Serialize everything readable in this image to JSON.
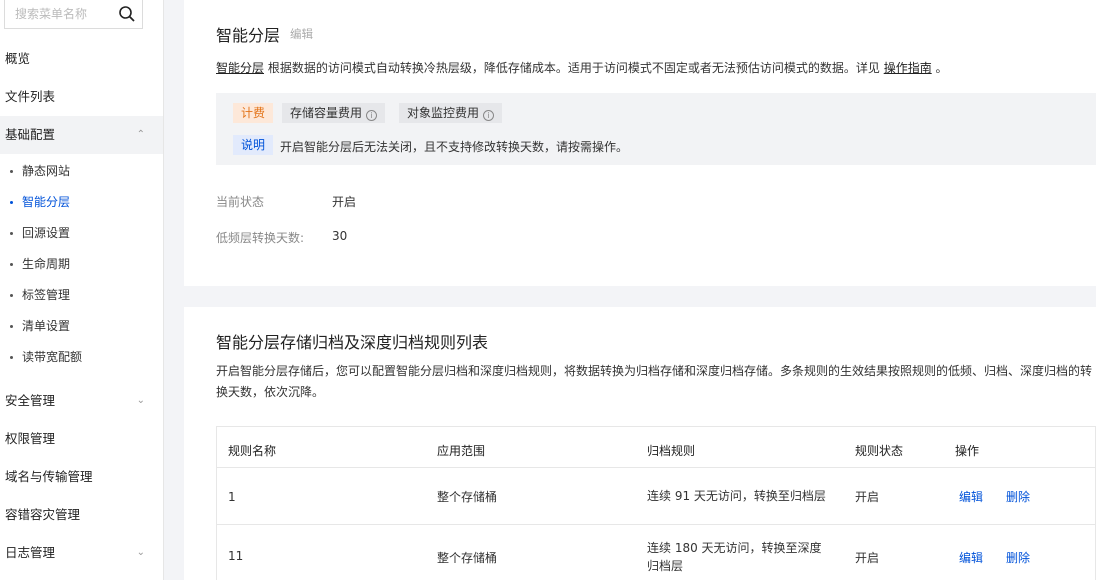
{
  "sidebar": {
    "search": {
      "placeholder": "搜索菜单名称",
      "value": ""
    },
    "items": {
      "overview": "概览",
      "file_list": "文件列表",
      "basic_config": "基础配置",
      "security": "安全管理",
      "permission": "权限管理",
      "domain": "域名与传输管理",
      "disaster": "容错容灾管理",
      "log": "日志管理"
    },
    "sub_items": {
      "static_site": "静态网站",
      "intelligent_tiering": "智能分层",
      "origin": "回源设置",
      "lifecycle": "生命周期",
      "tags": "标签管理",
      "inventory": "清单设置",
      "bandwidth": "读带宽配额"
    },
    "active_sub_item": "智能分层"
  },
  "tiering": {
    "title": "智能分层",
    "edit_label": "编辑",
    "desc_link": "智能分层",
    "desc_text": "根据数据的访问模式自动转换冷热层级，降低存储成本。适用于访问模式不固定或者无法预估访问模式的数据。详见",
    "guide_link": "操作指南",
    "desc_end": "。",
    "notice": {
      "billing_tag": "计费",
      "storage_fee": "存储容量费用",
      "monitor_fee": "对象监控费用",
      "info_tag": "说明",
      "info_text": "开启智能分层后无法关闭，且不支持修改转换天数，请按需操作。"
    },
    "status_label": "当前状态",
    "status_value": "开启",
    "days_label": "低频层转换天数:",
    "days_value": "30"
  },
  "rules": {
    "title": "智能分层存储归档及深度归档规则列表",
    "description": "开启智能分层存储后，您可以配置智能分层归档和深度归档规则，将数据转换为归档存储和深度归档存储。多条规则的生效结果按照规则的低频、归档、深度归档的转换天数，依次沉降。",
    "columns": {
      "name": "规则名称",
      "scope": "应用范围",
      "rule": "归档规则",
      "status": "规则状态",
      "ops": "操作"
    },
    "rows": [
      {
        "name": "1",
        "scope": "整个存储桶",
        "rule": "连续 91 天无访问，转换至归档层",
        "status": "开启",
        "edit": "编辑",
        "delete": "删除"
      },
      {
        "name": "11",
        "scope": "整个存储桶",
        "rule": "连续 180 天无访问，转换至深度归档层",
        "status": "开启",
        "edit": "编辑",
        "delete": "删除"
      }
    ]
  },
  "colors": {
    "accent": "#0052d9",
    "warning": "#e37318",
    "background": "#f3f4f7"
  }
}
